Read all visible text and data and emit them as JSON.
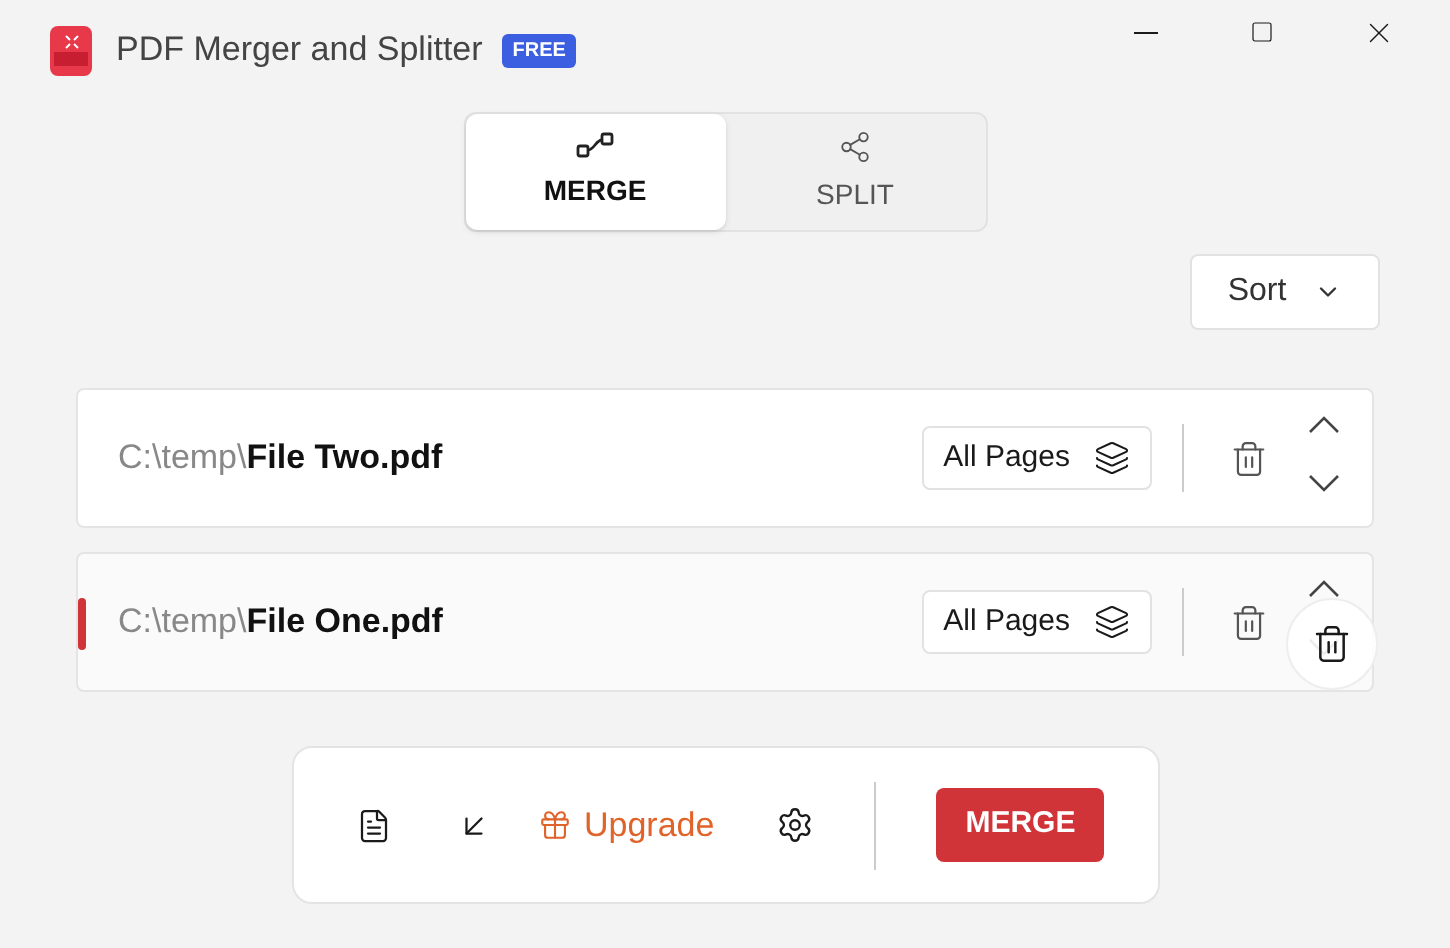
{
  "window": {
    "title": "PDF Merger and Splitter",
    "badge": "FREE"
  },
  "tabs": [
    {
      "label": "MERGE",
      "selected": true
    },
    {
      "label": "SPLIT",
      "selected": false
    }
  ],
  "sort": {
    "label": "Sort"
  },
  "files": [
    {
      "folder": "C:\\temp\\",
      "name": "File Two.pdf",
      "pages": "All Pages",
      "selected": false
    },
    {
      "folder": "C:\\temp\\",
      "name": "File One.pdf",
      "pages": "All Pages",
      "selected": true
    }
  ],
  "toolbar": {
    "upgrade": "Upgrade",
    "action": "MERGE"
  }
}
